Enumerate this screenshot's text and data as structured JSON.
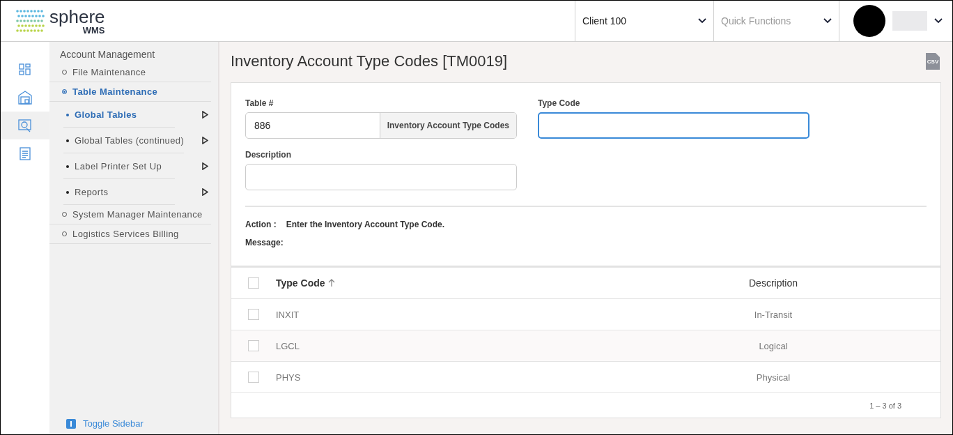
{
  "logo": {
    "name": "sphere",
    "sub": "WMS"
  },
  "header": {
    "client": "Client 100",
    "quick_functions": {
      "placeholder": "Quick Functions"
    }
  },
  "rail": [
    {
      "kind": "dashboard",
      "selected": false
    },
    {
      "kind": "warehouse",
      "selected": false
    },
    {
      "kind": "maintenance",
      "selected": true
    },
    {
      "kind": "reports",
      "selected": false
    }
  ],
  "sidebar": {
    "title": "Account Management",
    "items": [
      {
        "label": "File Maintenance",
        "selected": false
      },
      {
        "label": "Table Maintenance",
        "selected": true,
        "children": [
          {
            "label": "Global Tables",
            "selected": true
          },
          {
            "label": "Global Tables (continued)",
            "selected": false
          },
          {
            "label": "Label Printer Set Up",
            "selected": false
          },
          {
            "label": "Reports",
            "selected": false
          }
        ]
      },
      {
        "label": "System Manager Maintenance",
        "selected": false
      },
      {
        "label": "Logistics Services Billing",
        "selected": false
      }
    ],
    "toggle": "Toggle Sidebar"
  },
  "page": {
    "title": "Inventory Account Type Codes",
    "code": "[TM0019]",
    "export": "CSV"
  },
  "form": {
    "table_label": "Table #",
    "table_value": "886",
    "table_name": "Inventory Account Type Codes",
    "type_code_label": "Type Code",
    "description_label": "Description",
    "action_label": "Action :",
    "action_text": "Enter the Inventory Account Type Code.",
    "message_label": "Message:"
  },
  "table": {
    "columns": [
      "Type Code",
      "Description"
    ],
    "all_checked": false,
    "rows": [
      {
        "type_code": "INXIT",
        "description": "In-Transit",
        "checked": false
      },
      {
        "type_code": "LGCL",
        "description": "Logical",
        "checked": false
      },
      {
        "type_code": "PHYS",
        "description": "Physical",
        "checked": false
      }
    ],
    "pagination": "1 – 3 of 3"
  }
}
